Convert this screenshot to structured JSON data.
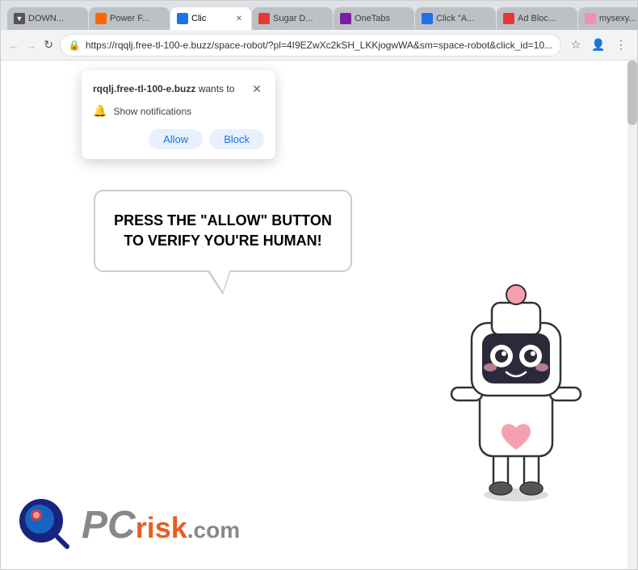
{
  "browser": {
    "tabs": [
      {
        "id": 1,
        "label": "DOWN...",
        "favicon_color": "#555",
        "active": false
      },
      {
        "id": 2,
        "label": "Power F...",
        "favicon_color": "#f60",
        "active": false
      },
      {
        "id": 3,
        "label": "Clic",
        "favicon_color": "#1a73e8",
        "active": true
      },
      {
        "id": 4,
        "label": "Sugar D...",
        "favicon_color": "#e53935",
        "active": false
      },
      {
        "id": 5,
        "label": "OneTabs",
        "favicon_color": "#7b1fa2",
        "active": false
      },
      {
        "id": 6,
        "label": "Click \"A...",
        "favicon_color": "#1a73e8",
        "active": false
      },
      {
        "id": 7,
        "label": "Ad Bloc...",
        "favicon_color": "#e53935",
        "active": false
      },
      {
        "id": 8,
        "label": "mysexy...",
        "favicon_color": "#f48fb1",
        "active": false
      }
    ],
    "url": "https://rqqlj.free-tl-100-e.buzz/space-robot/?pl=4I9EZwXc2kSH_LKKjogwWA&sm=space-robot&click_id=10...",
    "window_controls": {
      "minimize": "—",
      "maximize": "□",
      "close": "✕"
    }
  },
  "notification_popup": {
    "site": "rqqlj.free-tl-100-e.buzz",
    "wants_to": "wants to",
    "notification_text": "Show notifications",
    "allow_label": "Allow",
    "block_label": "Block",
    "close_label": "✕"
  },
  "page": {
    "bubble_text": "PRESS THE \"ALLOW\" BUTTON TO VERIFY YOU'RE HUMAN!",
    "pcrisk_pc": "PC",
    "pcrisk_risk": "risk",
    "pcrisk_dotcom": ".com"
  },
  "colors": {
    "allow_bg": "#d6e4fa",
    "allow_text": "#1a73e8",
    "block_bg": "#d6e4fa",
    "block_text": "#1a73e8"
  }
}
